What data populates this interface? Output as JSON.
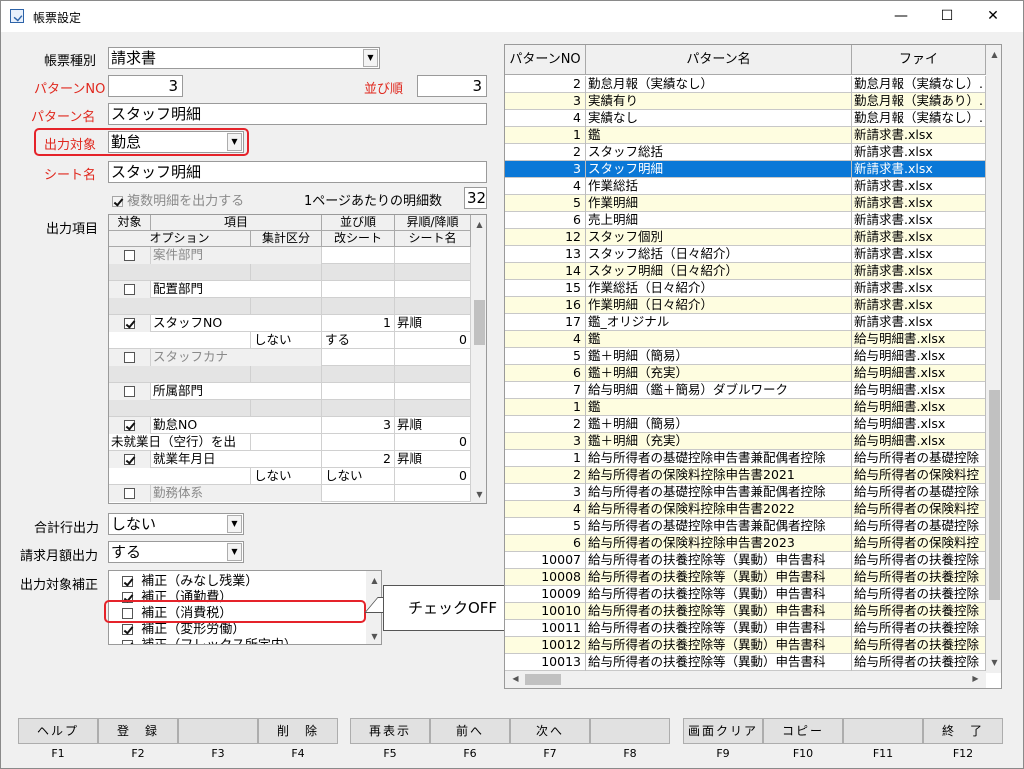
{
  "window": {
    "title": "帳票設定",
    "minimize": "—",
    "maximize": "☐",
    "close": "✕"
  },
  "form": {
    "report_type_label": "帳票種別",
    "report_type_value": "請求書",
    "pattern_no_label": "パターンNO",
    "pattern_no_value": "3",
    "sort_order_label": "並び順",
    "sort_order_value": "3",
    "pattern_name_label": "パターン名",
    "pattern_name_value": "スタッフ明細",
    "output_target_label": "出力対象",
    "output_target_value": "勤怠",
    "sheet_name_label": "シート名",
    "sheet_name_value": "スタッフ明細",
    "multi_detail_label": "複数明細を出力する",
    "per_page_label": "1ページあたりの明細数",
    "per_page_value": "32",
    "output_items_label": "出力項目",
    "total_row_label": "合計行出力",
    "total_row_value": "しない",
    "billing_amount_label": "請求月額出力",
    "billing_amount_value": "する",
    "correction_label": "出力対象補正"
  },
  "items_grid": {
    "headers": {
      "target": "対象",
      "item": "項目",
      "sort": "並び順",
      "asc_desc": "昇順/降順",
      "option": "オプション",
      "agg": "集計区分",
      "page_break": "改シート",
      "sheet_name": "シート名"
    },
    "rows": [
      {
        "name": "案件部門",
        "checked": false,
        "disabled": true,
        "sort": "",
        "order": "",
        "sub": {
          "opt": "",
          "agg": "",
          "brk": "",
          "sheet": ""
        }
      },
      {
        "name": "配置部門",
        "checked": false,
        "disabled": false,
        "sort": "",
        "order": "",
        "sub": {
          "opt": "",
          "agg": "",
          "brk": "",
          "sheet": ""
        }
      },
      {
        "name": "スタッフNO",
        "checked": true,
        "disabled": false,
        "sort": "1",
        "order": "昇順",
        "sub": {
          "opt": "",
          "agg": "しない",
          "brk": "する",
          "sheet": "0"
        }
      },
      {
        "name": "スタッフカナ",
        "checked": false,
        "disabled": true,
        "sort": "",
        "order": "",
        "sub": {
          "opt": "",
          "agg": "",
          "brk": "",
          "sheet": ""
        }
      },
      {
        "name": "所属部門",
        "checked": false,
        "disabled": false,
        "sort": "",
        "order": "",
        "sub": {
          "opt": "",
          "agg": "",
          "brk": "",
          "sheet": ""
        }
      },
      {
        "name": "勤怠NO",
        "checked": true,
        "disabled": false,
        "sort": "3",
        "order": "昇順",
        "sub": {
          "opt": "未就業日（空行）を出",
          "agg": "",
          "brk": "",
          "sheet": "0"
        }
      },
      {
        "name": "就業年月日",
        "checked": true,
        "disabled": false,
        "sort": "2",
        "order": "昇順",
        "sub": {
          "opt": "",
          "agg": "しない",
          "brk": "しない",
          "sheet": "0"
        }
      },
      {
        "name": "勤務体系",
        "checked": false,
        "disabled": true,
        "sort": "",
        "order": "",
        "sub": null
      }
    ]
  },
  "correction_items": [
    {
      "label": "補正（みなし残業）",
      "checked": true
    },
    {
      "label": "補正（通勤費）",
      "checked": true
    },
    {
      "label": "補正（消費税）",
      "checked": false
    },
    {
      "label": "補正（変形労働）",
      "checked": true
    },
    {
      "label": "補正（フレックス所定内）",
      "checked": true
    }
  ],
  "callout": {
    "text": "チェックOFF"
  },
  "pattern_grid": {
    "headers": {
      "no": "パターンNO",
      "name": "パターン名",
      "file": "ファイ"
    },
    "rows": [
      {
        "no": "2",
        "name": "勤怠月報（実績なし）",
        "file": "勤怠月報（実績なし）.",
        "color": "w"
      },
      {
        "no": "3",
        "name": "実績有り",
        "file": "勤怠月報（実績あり）.",
        "color": "y"
      },
      {
        "no": "4",
        "name": "実績なし",
        "file": "勤怠月報（実績なし）.",
        "color": "w"
      },
      {
        "no": "1",
        "name": "鑑",
        "file": "新請求書.xlsx",
        "color": "y"
      },
      {
        "no": "2",
        "name": "スタッフ総括",
        "file": "新請求書.xlsx",
        "color": "w"
      },
      {
        "no": "3",
        "name": "スタッフ明細",
        "file": "新請求書.xlsx",
        "color": "sel"
      },
      {
        "no": "4",
        "name": "作業総括",
        "file": "新請求書.xlsx",
        "color": "w"
      },
      {
        "no": "5",
        "name": "作業明細",
        "file": "新請求書.xlsx",
        "color": "y"
      },
      {
        "no": "6",
        "name": "売上明細",
        "file": "新請求書.xlsx",
        "color": "w"
      },
      {
        "no": "12",
        "name": "スタッフ個別",
        "file": "新請求書.xlsx",
        "color": "y"
      },
      {
        "no": "13",
        "name": "スタッフ総括（日々紹介）",
        "file": "新請求書.xlsx",
        "color": "w"
      },
      {
        "no": "14",
        "name": "スタッフ明細（日々紹介）",
        "file": "新請求書.xlsx",
        "color": "y"
      },
      {
        "no": "15",
        "name": "作業総括（日々紹介）",
        "file": "新請求書.xlsx",
        "color": "w"
      },
      {
        "no": "16",
        "name": "作業明細（日々紹介）",
        "file": "新請求書.xlsx",
        "color": "y"
      },
      {
        "no": "17",
        "name": "鑑_オリジナル",
        "file": "新請求書.xlsx",
        "color": "w"
      },
      {
        "no": "4",
        "name": "鑑",
        "file": "給与明細書.xlsx",
        "color": "y"
      },
      {
        "no": "5",
        "name": "鑑＋明細（簡易）",
        "file": "給与明細書.xlsx",
        "color": "w"
      },
      {
        "no": "6",
        "name": "鑑＋明細（充実）",
        "file": "給与明細書.xlsx",
        "color": "y"
      },
      {
        "no": "7",
        "name": "給与明細（鑑＋簡易）ダブルワーク",
        "file": "給与明細書.xlsx",
        "color": "w"
      },
      {
        "no": "1",
        "name": "鑑",
        "file": "給与明細書.xlsx",
        "color": "y"
      },
      {
        "no": "2",
        "name": "鑑＋明細（簡易）",
        "file": "給与明細書.xlsx",
        "color": "w"
      },
      {
        "no": "3",
        "name": "鑑＋明細（充実）",
        "file": "給与明細書.xlsx",
        "color": "y"
      },
      {
        "no": "1",
        "name": "給与所得者の基礎控除申告書兼配偶者控除",
        "file": "給与所得者の基礎控除",
        "color": "w"
      },
      {
        "no": "2",
        "name": "給与所得者の保険料控除申告書2021",
        "file": "給与所得者の保険料控",
        "color": "y"
      },
      {
        "no": "3",
        "name": "給与所得者の基礎控除申告書兼配偶者控除",
        "file": "給与所得者の基礎控除",
        "color": "w"
      },
      {
        "no": "4",
        "name": "給与所得者の保険料控除申告書2022",
        "file": "給与所得者の保険料控",
        "color": "y"
      },
      {
        "no": "5",
        "name": "給与所得者の基礎控除申告書兼配偶者控除",
        "file": "給与所得者の基礎控除",
        "color": "w"
      },
      {
        "no": "6",
        "name": "給与所得者の保険料控除申告書2023",
        "file": "給与所得者の保険料控",
        "color": "y"
      },
      {
        "no": "10007",
        "name": "給与所得者の扶養控除等（異動）申告書科",
        "file": "給与所得者の扶養控除",
        "color": "w"
      },
      {
        "no": "10008",
        "name": "給与所得者の扶養控除等（異動）申告書科",
        "file": "給与所得者の扶養控除",
        "color": "y"
      },
      {
        "no": "10009",
        "name": "給与所得者の扶養控除等（異動）申告書科",
        "file": "給与所得者の扶養控除",
        "color": "w"
      },
      {
        "no": "10010",
        "name": "給与所得者の扶養控除等（異動）申告書科",
        "file": "給与所得者の扶養控除",
        "color": "y"
      },
      {
        "no": "10011",
        "name": "給与所得者の扶養控除等（異動）申告書科",
        "file": "給与所得者の扶養控除",
        "color": "w"
      },
      {
        "no": "10012",
        "name": "給与所得者の扶養控除等（異動）申告書科",
        "file": "給与所得者の扶養控除",
        "color": "y"
      },
      {
        "no": "10013",
        "name": "給与所得者の扶養控除等（異動）申告書科",
        "file": "給与所得者の扶養控除",
        "color": "w"
      }
    ]
  },
  "function_keys": [
    {
      "label": "ヘルプ",
      "key": "F1"
    },
    {
      "label": "登　録",
      "key": "F2"
    },
    {
      "label": "",
      "key": "F3"
    },
    {
      "label": "削　除",
      "key": "F4"
    },
    {
      "label": "再表示",
      "key": "F5"
    },
    {
      "label": "前へ",
      "key": "F6"
    },
    {
      "label": "次へ",
      "key": "F7"
    },
    {
      "label": "",
      "key": "F8"
    },
    {
      "label": "画面クリア",
      "key": "F9"
    },
    {
      "label": "コピー",
      "key": "F10"
    },
    {
      "label": "",
      "key": "F11"
    },
    {
      "label": "終　了",
      "key": "F12"
    }
  ]
}
